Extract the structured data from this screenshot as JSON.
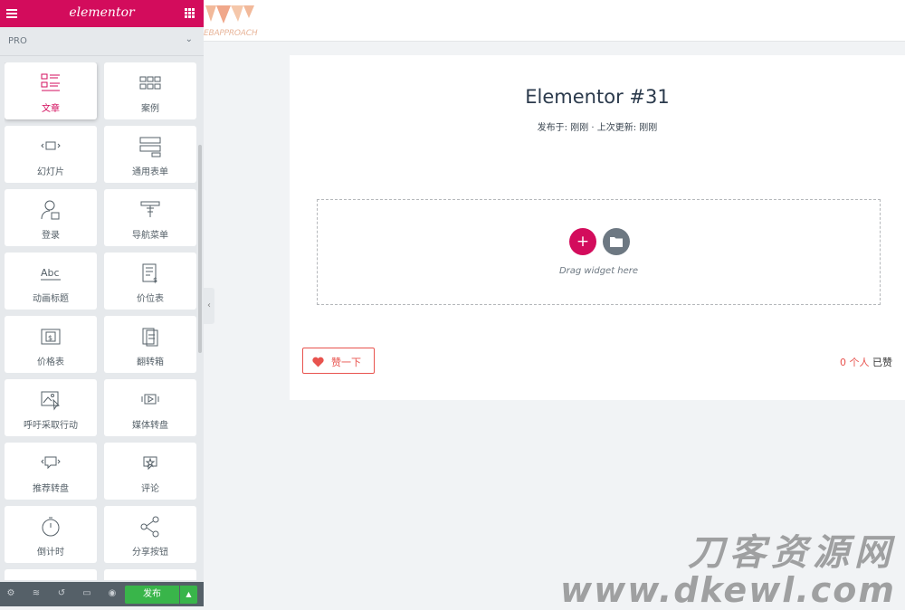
{
  "panel": {
    "logo": "elementor",
    "section_title": "PRO",
    "widgets": [
      {
        "label": "文章",
        "icon": "posts-icon",
        "active": true
      },
      {
        "label": "案例",
        "icon": "portfolio-icon",
        "active": false
      },
      {
        "label": "幻灯片",
        "icon": "slides-icon",
        "active": false
      },
      {
        "label": "通用表单",
        "icon": "form-icon",
        "active": false
      },
      {
        "label": "登录",
        "icon": "login-icon",
        "active": false
      },
      {
        "label": "导航菜单",
        "icon": "nav-menu-icon",
        "active": false
      },
      {
        "label": "动画标题",
        "icon": "animated-headline-icon",
        "active": false
      },
      {
        "label": "价位表",
        "icon": "price-list-icon",
        "active": false
      },
      {
        "label": "价格表",
        "icon": "price-table-icon",
        "active": false
      },
      {
        "label": "翻转箱",
        "icon": "flip-box-icon",
        "active": false
      },
      {
        "label": "呼吁采取行动",
        "icon": "call-to-action-icon",
        "active": false
      },
      {
        "label": "媒体转盘",
        "icon": "media-carousel-icon",
        "active": false
      },
      {
        "label": "推荐转盘",
        "icon": "testimonial-carousel-icon",
        "active": false
      },
      {
        "label": "评论",
        "icon": "reviews-icon",
        "active": false
      },
      {
        "label": "倒计时",
        "icon": "countdown-icon",
        "active": false
      },
      {
        "label": "分享按钮",
        "icon": "share-icon",
        "active": false
      }
    ],
    "footer": {
      "publish_label": "发布"
    }
  },
  "site": {
    "logo_text": "EBAPPROACH"
  },
  "content": {
    "title": "Elementor #31",
    "meta": "发布于: 刚刚 · 上次更新: 刚刚",
    "drop_hint": "Drag widget here",
    "like_label": "赞一下",
    "like_count": "0 个人",
    "like_suffix": "已赞"
  },
  "watermark": {
    "line1": "刀客资源网",
    "line2": "www.dkewl.com"
  },
  "colors": {
    "accent": "#d30c5c",
    "publish": "#39b54a",
    "like": "#e8534e"
  }
}
